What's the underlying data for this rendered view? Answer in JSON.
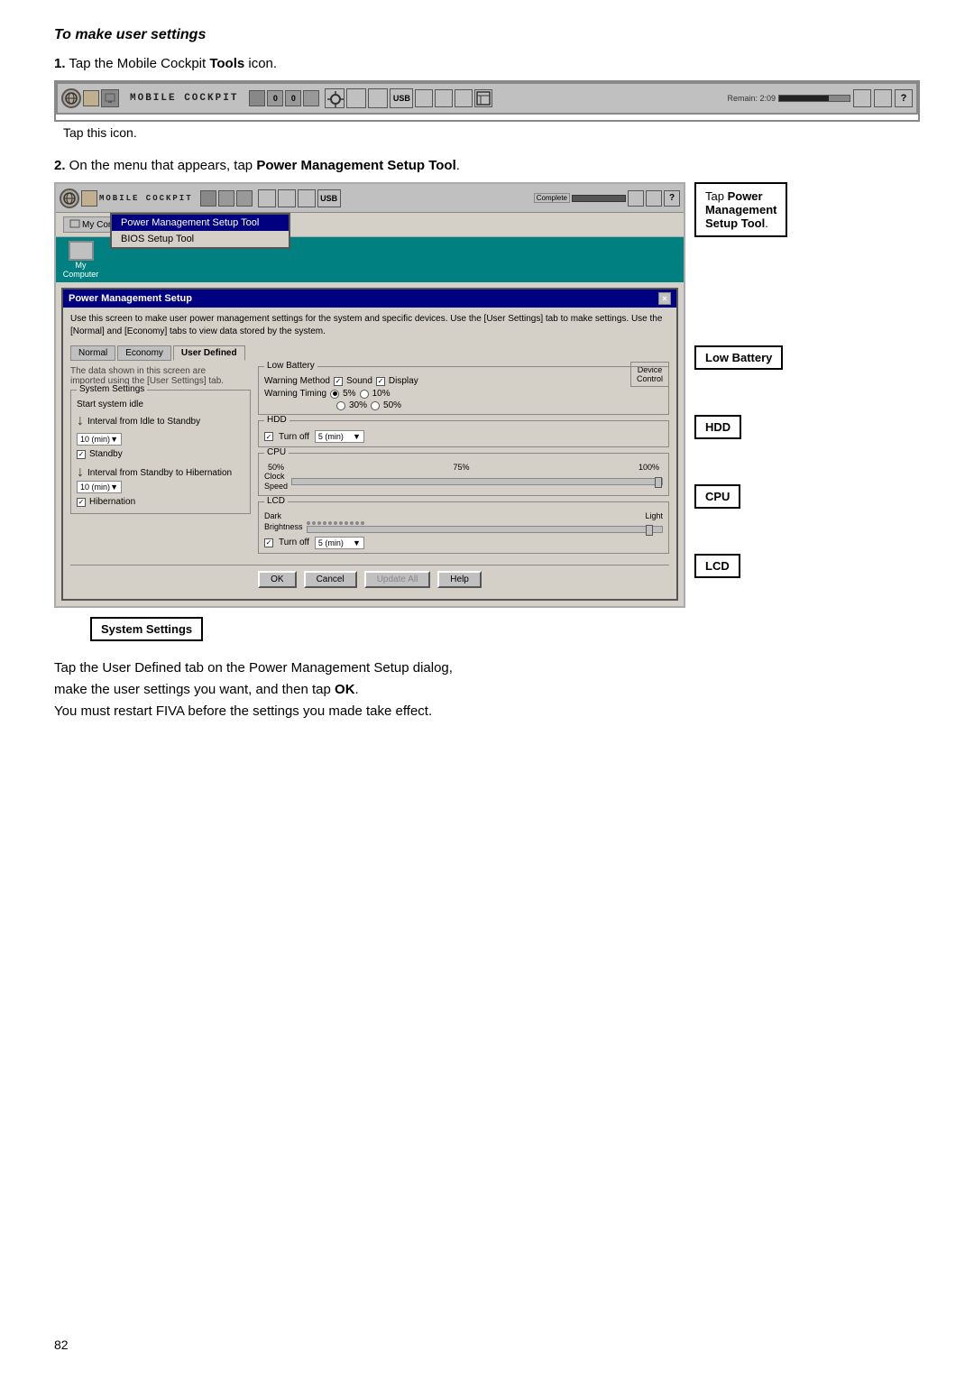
{
  "page": {
    "number": "82"
  },
  "section": {
    "title": "To make user settings"
  },
  "steps": [
    {
      "number": "1.",
      "text": "Tap the Mobile Cockpit ",
      "bold": "Tools",
      "text2": " icon."
    },
    {
      "number": "2.",
      "text": "On the menu that appears, tap ",
      "bold": "Power Management Setup Tool",
      "text2": "."
    }
  ],
  "tap_icon_label": "Tap this icon.",
  "taskbar1": {
    "title": "MOBILE COCKPIT",
    "remain": "Remain: 2:09"
  },
  "taskbar2": {
    "title": "MOBILE COCKPIT"
  },
  "dropdown": {
    "items": [
      {
        "label": "Power Management Setup Tool",
        "selected": true
      },
      {
        "label": "BIOS Setup Tool",
        "selected": false
      }
    ]
  },
  "callouts": {
    "tap_power": "Tap Power\nManagement\nSetup Tool.",
    "low_battery": "Low Battery",
    "hdd": "HDD",
    "cpu": "CPU",
    "lcd": "LCD",
    "system_settings": "System Settings"
  },
  "dialog": {
    "title": "Power Management Setup",
    "close_btn": "×",
    "description": "Use this screen to make user power management settings for the system and specific devices. Use the [User Settings] tab to make settings. Use the [Normal] and [Economy] tabs to view data stored by the system.",
    "tabs": [
      "Normal",
      "Economy",
      "User Defined"
    ],
    "active_tab": "User Defined",
    "device_control": "Device\nControl",
    "system_settings": {
      "title": "System Settings",
      "text": "Start system idle",
      "interval_standby": "Interval from Idle to Standby",
      "standby_value": "10 (min)",
      "standby_check": "Standby",
      "interval_hibernation": "Interval from Standby to Hibernation",
      "hibernation_value": "10 (min)",
      "hibernation_check": "Hibernation"
    },
    "low_battery": {
      "title": "Low Battery",
      "warning_method_label": "Warning Method",
      "sound_label": "Sound",
      "display_label": "Display",
      "warning_timing_label": "Warning Timing",
      "timing_options": [
        "5%",
        "10%",
        "30%",
        "50%"
      ]
    },
    "hdd": {
      "title": "HDD",
      "turn_off_label": "Turn off",
      "value": "5 (min)"
    },
    "cpu": {
      "title": "CPU",
      "speed_label": "Clock\nSpeed",
      "percent_labels": [
        "50%",
        "75%",
        "100%"
      ]
    },
    "lcd": {
      "title": "LCD",
      "dark_label": "Dark",
      "light_label": "Light",
      "brightness_label": "Brightness",
      "turn_off_label": "Turn off",
      "value": "5 (min)"
    },
    "buttons": [
      "OK",
      "Cancel",
      "Update All",
      "Help"
    ]
  },
  "instruction": {
    "line1": "Tap the User Defined tab on the Power Management Setup dialog,",
    "line2": "make the user settings you want, and then tap ",
    "line2_bold": "OK",
    "line2_end": ".",
    "line3": "You must restart FIVA before the settings you made take effect."
  }
}
